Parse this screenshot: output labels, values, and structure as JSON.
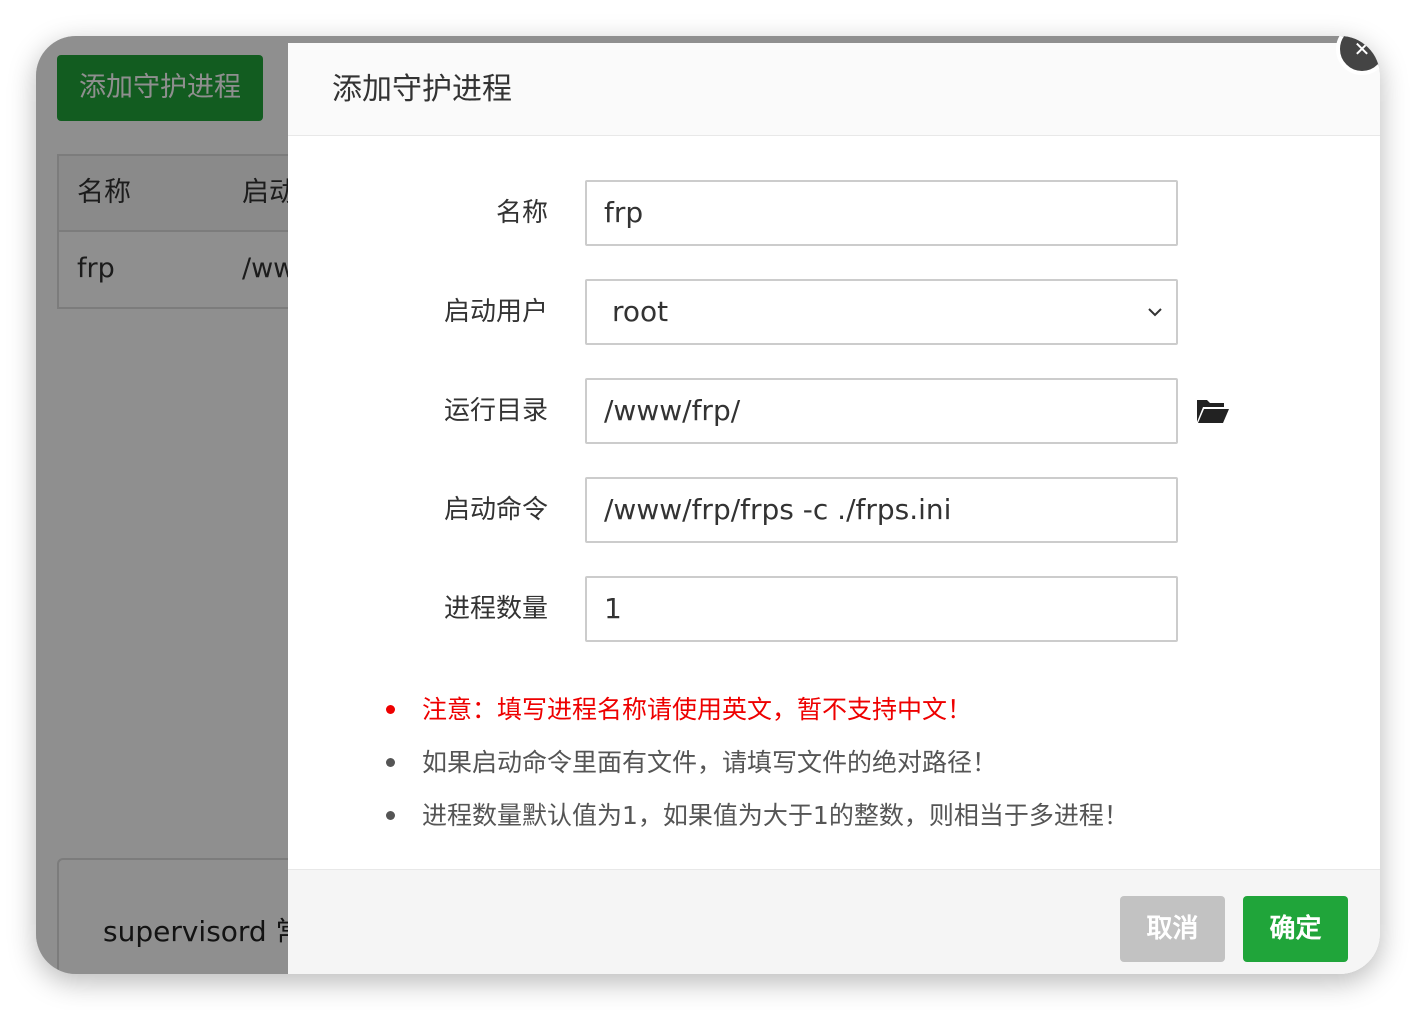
{
  "background": {
    "add_button_label": "添加守护进程",
    "table": {
      "headers": [
        "名称",
        "启动"
      ],
      "rows": [
        [
          "frp",
          "/ww"
        ]
      ]
    },
    "panel_text": "supervisord 常"
  },
  "modal": {
    "title": "添加守护进程",
    "close_icon": "close-icon",
    "fields": {
      "name": {
        "label": "名称",
        "value": "frp"
      },
      "user": {
        "label": "启动用户",
        "value": "root"
      },
      "directory": {
        "label": "运行目录",
        "value": "/www/frp/"
      },
      "command": {
        "label": "启动命令",
        "value": "/www/frp/frps -c ./frps.ini"
      },
      "count": {
        "label": "进程数量",
        "value": "1"
      }
    },
    "notes": [
      "注意：填写进程名称请使用英文，暂不支持中文！",
      "如果启动命令里面有文件，请填写文件的绝对路径！",
      "进程数量默认值为1，如果值为大于1的整数，则相当于多进程！"
    ],
    "buttons": {
      "cancel": "取消",
      "confirm": "确定"
    }
  },
  "colors": {
    "accent": "#20a53a",
    "warning": "#ee0000",
    "cancel": "#c2c2c2"
  }
}
